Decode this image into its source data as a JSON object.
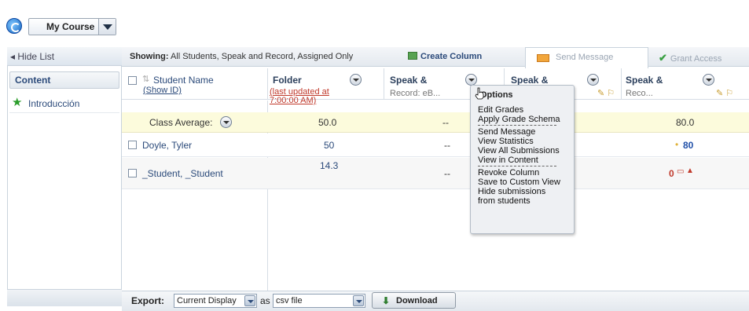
{
  "course": {
    "selected": "My Course"
  },
  "sidebar": {
    "hide_list": "◂ Hide List",
    "tab": "Content",
    "items": [
      {
        "label": "Introducción"
      }
    ]
  },
  "toolbar": {
    "showing_label": "Showing:",
    "showing_value": "All Students, Speak and Record, Assigned Only",
    "create_column": "Create Column",
    "send_message": "Send Message",
    "grant_access": "Grant Access"
  },
  "columns": {
    "student_name": "Student Name",
    "show_id": "(Show ID)",
    "folder_title": "Folder",
    "folder_sub": "(last updated at 7:00:00 AM)",
    "speak1_title": "Speak &",
    "speak1_sub": "Record: eB...",
    "speak2_title": "Speak &",
    "speak3_title": "Speak &",
    "speak3_sub": "Reco..."
  },
  "rows": {
    "average_label": "Class Average:",
    "average": {
      "folder": "50.0",
      "speak1": "--",
      "speak3": "80.0"
    },
    "students": [
      {
        "name": "Doyle, Tyler",
        "folder": "50",
        "speak1": "--",
        "speak3": "80"
      },
      {
        "name": "_Student, _Student",
        "folder": "14.3",
        "speak1": "--",
        "speak3": "0"
      }
    ]
  },
  "options_menu": {
    "header": "Options",
    "items": [
      "Edit Grades",
      "Apply Grade Schema",
      "Send Message",
      "View Statistics",
      "View All Submissions",
      "View in Content",
      "Revoke Column",
      "Save to Custom View",
      "Hide submissions",
      "from students"
    ]
  },
  "export": {
    "label": "Export:",
    "display_value": "Current Display",
    "as": "as",
    "format_value": "csv file",
    "download": "Download"
  },
  "icons": {
    "course": "course-globe-icon",
    "star": "star-icon",
    "envelope": "envelope-icon",
    "check": "check-icon"
  }
}
